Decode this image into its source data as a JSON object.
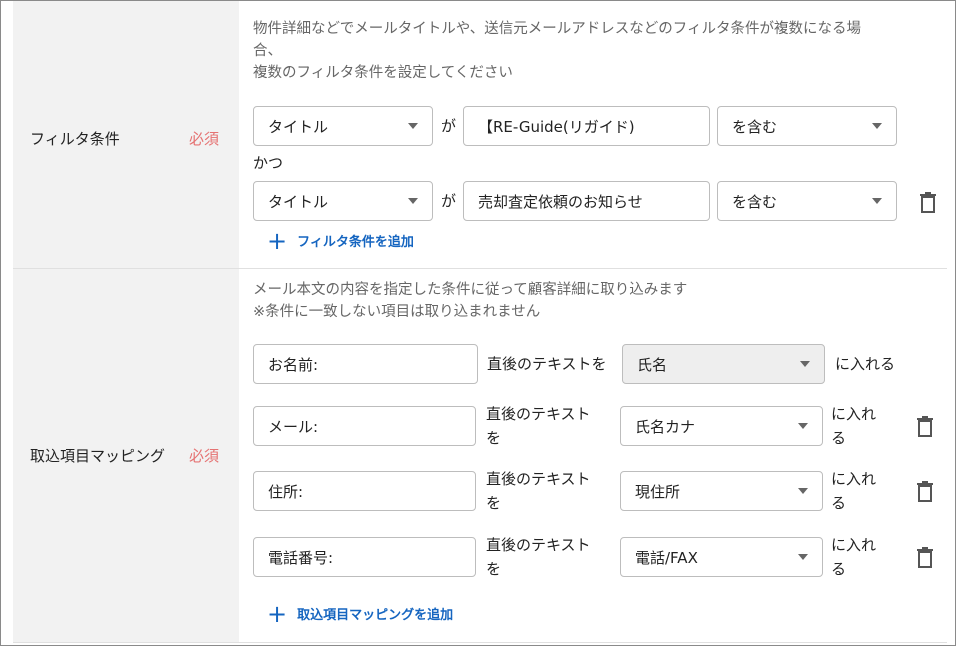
{
  "filter": {
    "label": "フィルタ条件",
    "required": "必須",
    "description": [
      "物件詳細などでメールタイトルや、送信元メールアドレスなどのフィルタ条件が複数になる場",
      "合、",
      "複数のフィルタ条件を設定してください"
    ],
    "conditions": [
      {
        "field": "タイトル",
        "connector": "が",
        "value": "【RE-Guide(リガイド)",
        "operator": "を含む"
      },
      {
        "field": "タイトル",
        "connector": "が",
        "value": "売却査定依頼のお知らせ",
        "operator": "を含む"
      }
    ],
    "and_label": "かつ",
    "add_label": "フィルタ条件を追加"
  },
  "mapping": {
    "label": "取込項目マッピング",
    "required": "必須",
    "description": [
      "メール本文の内容を指定した条件に従って顧客詳細に取り込みます",
      "※条件に一致しない項目は取り込まれません"
    ],
    "rows": [
      {
        "key": "お名前:",
        "mid": "直後のテキストを",
        "target": "氏名",
        "suffix": "に入れる"
      },
      {
        "key": "メール:",
        "mid1": "直後のテキスト",
        "mid2": "を",
        "target": "氏名カナ",
        "suffix1": "に入れ",
        "suffix2": "る"
      },
      {
        "key": "住所:",
        "mid1": "直後のテキスト",
        "mid2": "を",
        "target": "現住所",
        "suffix1": "に入れ",
        "suffix2": "る"
      },
      {
        "key": "電話番号:",
        "mid1": "直後のテキスト",
        "mid2": "を",
        "target": "電話/FAX",
        "suffix1": "に入れ",
        "suffix2": "る"
      }
    ],
    "add_label": "取込項目マッピングを追加"
  }
}
